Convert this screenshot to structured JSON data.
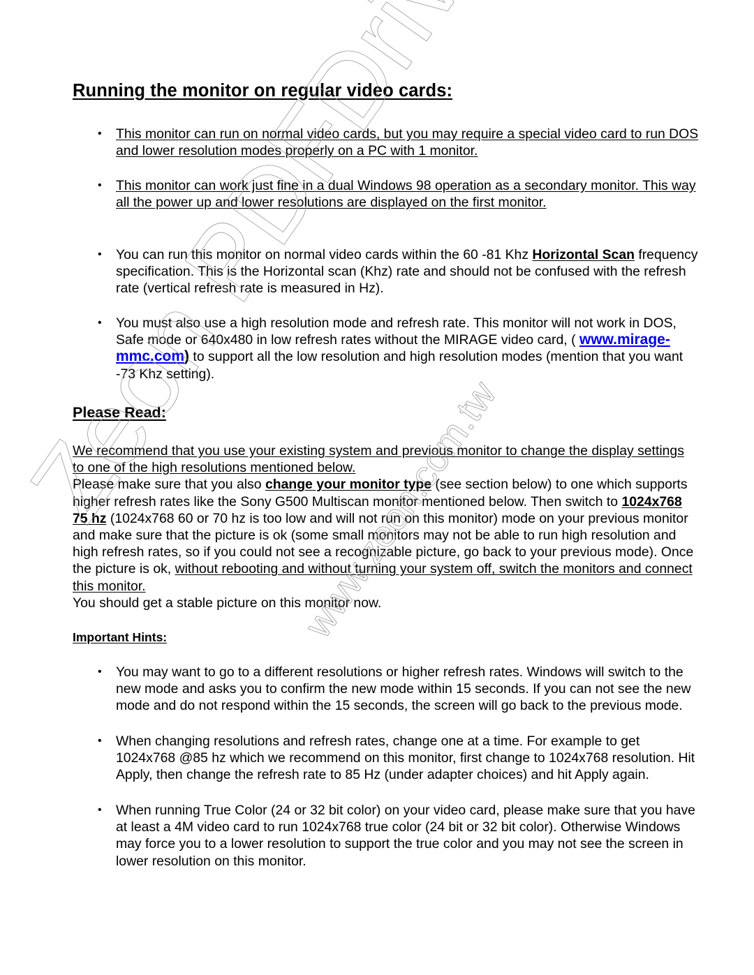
{
  "document": {
    "title": "Running the monitor on regular video cards:",
    "section1_bullets": [
      {
        "text": "This monitor can run on normal video cards, but you may require a special video card to run DOS and lower resolution modes properly on a PC with 1 monitor."
      },
      {
        "text": "This monitor can work just fine in a dual Windows 98 operation as a secondary monitor. This way all the power up and lower resolutions are displayed on the first monitor."
      },
      {
        "pre": "You can run this monitor on normal video cards within  the 60 -81 Khz ",
        "bold": "Horizontal Scan",
        "post": " frequency specification. This is the Horizontal scan (Khz) rate and should not be confused with the refresh rate (vertical refresh rate is measured in Hz)."
      },
      {
        "pre": "You must also use a high resolution mode and refresh rate. This monitor will not work in DOS, Safe mode or 640x480 in low refresh rates without the MIRAGE video card, ( ",
        "link": "www.mirage-mmc.com",
        "paren": ")",
        "post": "  to support all the low resolution and high resolution modes (mention that you want -73 Khz setting)."
      }
    ],
    "please_read": {
      "heading": "Please Read:",
      "underlined_intro": "We recommend that you use your existing system and previous monitor to change the display settings to one of the high resolutions mentioned below.",
      "p1_pre": " Please make sure that you also ",
      "p1_bold": "change your monitor type",
      "p1_mid": " (see section below) to one which supports higher refresh rates  like the Sony G500 Multiscan monitor mentioned below. Then switch to ",
      "p1_bold2": "1024x768 75 hz",
      "p1_post": "  (1024x768 60 or 70 hz is too low and will not run on this monitor) mode on your previous monitor and make sure that the picture is ok (some small monitors may not be able to run high resolution and high refresh rates, so if you could not see a recognizable picture, go back to your previous mode). Once the picture is ok, ",
      "p1_underlined": "without rebooting and without turning your system off, switch the monitors and connect this monitor.",
      "p1_end": " You should get a stable picture on this monitor now."
    },
    "important_hints": {
      "heading": "Important Hints:",
      "bullets": [
        "You may want to go to a different resolutions or higher refresh rates. Windows will switch to the new mode and asks you to confirm the new mode within 15 seconds. If you can not see the new mode and do not respond within the 15 seconds, the screen will go back to the previous mode.",
        "When changing resolutions and refresh rates, change one at a time. For example to get 1024x768 @85 hz  which we recommend on this monitor, first change to 1024x768 resolution. Hit Apply, then change the refresh rate to 85 Hz (under adapter choices) and hit  Apply again.",
        "When running True Color (24 or 32 bit color) on your video card, please make sure that you have at least a 4M video card to run 1024x768 true color (24 bit or 32 bit color). Otherwise Windows may force you to a lower resolution to support the true color and you may not see the screen in lower resolution on this monitor."
      ]
    },
    "bullet_glyph": "•",
    "watermark": {
      "main": "Zeon PDFDriver Trial",
      "url": "www.zeon.com.tw"
    }
  }
}
